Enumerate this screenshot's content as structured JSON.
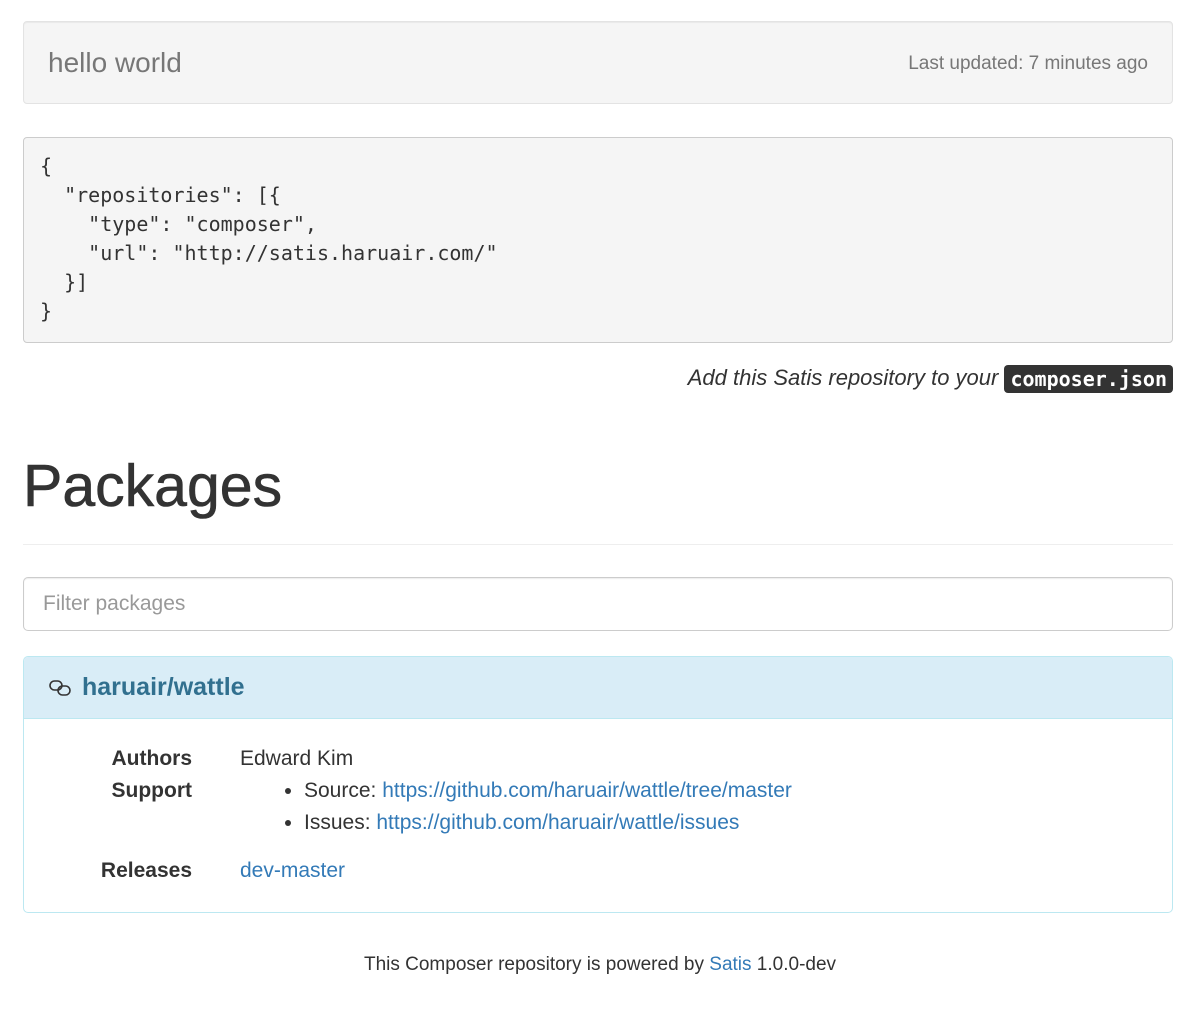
{
  "header": {
    "title": "hello world",
    "last_updated": "Last updated: 7 minutes ago"
  },
  "repository_snippet": {
    "code": "{\n  \"repositories\": [{\n    \"type\": \"composer\",\n    \"url\": \"http://satis.haruair.com/\"\n  }]\n}",
    "hint_text": "Add this Satis repository to your ",
    "hint_code": "composer.json"
  },
  "packages": {
    "heading": "Packages",
    "filter_placeholder": "Filter packages",
    "filter_value": "",
    "items": [
      {
        "name": "haruair/wattle",
        "icon": "link-icon",
        "authors_label": "Authors",
        "authors": "Edward Kim",
        "support_label": "Support",
        "support": [
          {
            "label": "Source: ",
            "url": "https://github.com/haruair/wattle/tree/master"
          },
          {
            "label": "Issues: ",
            "url": "https://github.com/haruair/wattle/issues"
          }
        ],
        "releases_label": "Releases",
        "releases": [
          "dev-master"
        ]
      }
    ]
  },
  "footer": {
    "prefix": "This Composer repository is powered by ",
    "link": "Satis",
    "suffix": " 1.0.0-dev"
  },
  "colors": {
    "link": "#337ab7",
    "panel_heading_bg": "#d9edf7",
    "panel_title": "#31708f",
    "well_bg": "#f5f5f5"
  }
}
